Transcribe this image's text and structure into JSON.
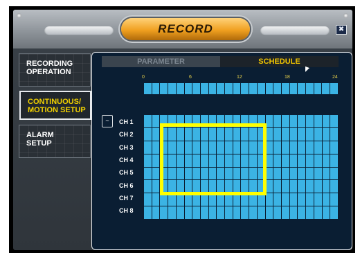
{
  "window": {
    "title": "RECORD",
    "close_glyph": "✖"
  },
  "sidebar": {
    "items": [
      {
        "label": "RECORDING\nOPERATION",
        "active": false
      },
      {
        "label": "CONTINUOUS/\nMOTION SETUP",
        "active": true
      },
      {
        "label": "ALARM\nSETUP",
        "active": false
      }
    ]
  },
  "tabs": {
    "parameter": "PARAMETER",
    "schedule": "SCHEDULE"
  },
  "hour_ticks": [
    "0",
    "6",
    "12",
    "18",
    "24"
  ],
  "channels": [
    "CH 1",
    "CH 2",
    "CH 3",
    "CH 4",
    "CH 5",
    "CH 6",
    "CH 7",
    "CH 8"
  ],
  "copy_glyph": "~",
  "colors": {
    "schedule_cell": "#3bb3e4",
    "active_text": "#f0d000",
    "highlight": "#ffff00",
    "title_orange": "#f0a020"
  }
}
